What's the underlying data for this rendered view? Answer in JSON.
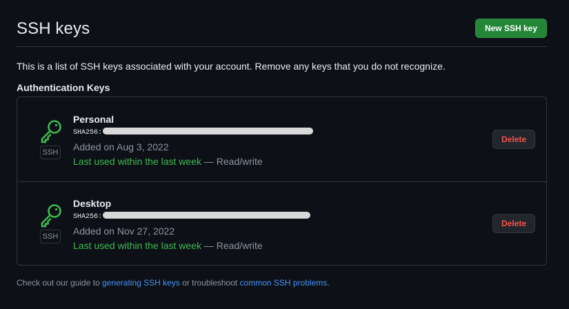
{
  "header": {
    "title": "SSH keys",
    "new_key_label": "New SSH key"
  },
  "intro_text": "This is a list of SSH keys associated with your account. Remove any keys that you do not recognize.",
  "section_heading": "Authentication Keys",
  "keys": [
    {
      "title": "Personal",
      "badge": "SSH",
      "fingerprint_prefix": "SHA256:",
      "added": "Added on Aug 3, 2022",
      "last_used": "Last used within the last week",
      "access": " — Read/write",
      "delete_label": "Delete",
      "icon": "key-icon"
    },
    {
      "title": "Desktop",
      "badge": "SSH",
      "fingerprint_prefix": "SHA256:",
      "added": "Added on Nov 27, 2022",
      "last_used": "Last used within the last week",
      "access": " — Read/write",
      "delete_label": "Delete",
      "icon": "key-icon"
    }
  ],
  "footer": {
    "prefix": "Check out our guide to ",
    "link1": "generating SSH keys",
    "middle": " or troubleshoot ",
    "link2": "common SSH problems",
    "suffix": "."
  },
  "colors": {
    "background": "#0d1117",
    "primary_button": "#238636",
    "danger_text": "#f85149",
    "key_icon": "#3fb950",
    "link": "#4493f8"
  }
}
